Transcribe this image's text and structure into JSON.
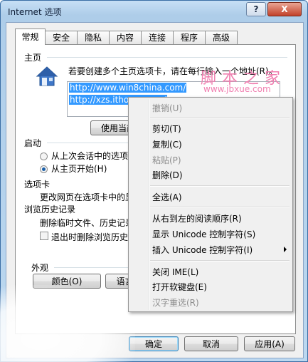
{
  "window": {
    "title": "Internet 选项",
    "help_button": "?",
    "close_button": "X"
  },
  "tabs": [
    "常规",
    "安全",
    "隐私",
    "内容",
    "连接",
    "程序",
    "高级"
  ],
  "home_page": {
    "section_title": "主页",
    "description": "若要创建多个主页选项卡，请在每行输入一个地址(R)。",
    "urls": [
      "http://www.win8china.com/",
      "http://xzs.ithome.com/"
    ],
    "use_current_button": "使用当前页"
  },
  "startup": {
    "section_title": "启动",
    "option_last_session": "从上次会话中的选项卡",
    "option_home_page": "从主页开始(H)",
    "selected": "option_home_page"
  },
  "tabs_section": {
    "section_title": "选项卡",
    "description": "更改网页在选项卡中的显示"
  },
  "history": {
    "section_title": "浏览历史记录",
    "description": "删除临时文件、历史记录",
    "delete_on_exit": "退出时删除浏览历史记",
    "delete_on_exit_checked": false
  },
  "appearance": {
    "section_title": "外观",
    "colors_button": "颜色(O)",
    "languages_button": "语言("
  },
  "dialog_buttons": {
    "ok": "确定",
    "cancel": "取消",
    "apply": "应用(A)"
  },
  "context_menu": {
    "undo": "撤销(U)",
    "cut": "剪切(T)",
    "copy": "复制(C)",
    "paste": "粘贴(P)",
    "delete": "删除(D)",
    "select_all": "全选(A)",
    "rtl": "从右到左的阅读顺序(R)",
    "show_unicode": "显示 Unicode 控制字符(S)",
    "insert_unicode": "插入 Unicode 控制字符(I)",
    "close_ime": "关闭 IME(L)",
    "soft_keyboard": "打开软键盘(E)",
    "reconversion": "汉字重选(R)"
  },
  "watermark": {
    "line1": "脚本之家",
    "line2": "www.jbxue.com"
  },
  "colors": {
    "selection": "#3399ff",
    "watermark": "#f07fb0",
    "title_bar": "#b9d3ee"
  }
}
